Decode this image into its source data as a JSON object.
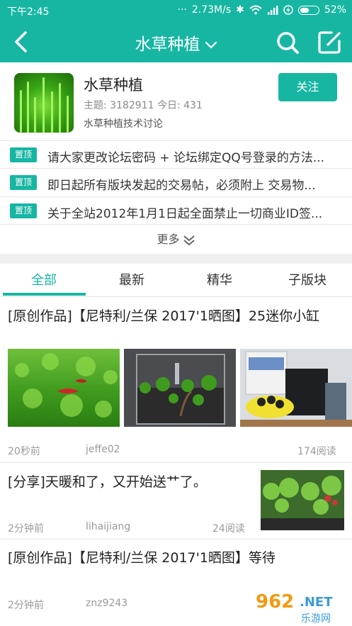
{
  "status_bar": {
    "time": "下午2:45",
    "speed": "2.73M/s",
    "battery": "52%",
    "battery_level": 0.52
  },
  "header": {
    "title": "水草种植",
    "back_icon": "back-arrow-icon",
    "search_icon": "search-icon",
    "compose_icon": "compose-icon"
  },
  "forum": {
    "name": "水草种植",
    "stats": "主题: 3182911  今日: 431",
    "description": "水草种植技术讨论",
    "follow_label": "关注"
  },
  "pinned": [
    {
      "badge": "置顶",
      "text": "请大家更改论坛密码 + 论坛绑定QQ号登录的方法..."
    },
    {
      "badge": "置顶",
      "text": "即日起所有版块发起的交易帖，必须附上 交易物..."
    },
    {
      "badge": "置顶",
      "text": "关于全站2012年1月1日起全面禁止一切商业ID签..."
    }
  ],
  "more_label": "更多",
  "tabs": [
    "全部",
    "最新",
    "精华",
    "子版块"
  ],
  "posts": [
    {
      "title": "[原创作品]【尼特利/兰保 2017'1晒图】25迷你小缸",
      "time": "20秒前",
      "author": "jeffe02",
      "views": "174阅读"
    },
    {
      "title": "[分享]天暖和了，又开始送艹了。",
      "time": "2分钟前",
      "author": "lihaijiang",
      "views": "24阅读"
    },
    {
      "title": "[原创作品]【尼特利/兰保 2017'1晒图】等待",
      "time": "2分钟前",
      "author": "znz9243",
      "views": ""
    }
  ],
  "watermark": {
    "main": "962.NET",
    "sub": "乐游网"
  },
  "colors": {
    "accent": "#17b6a3"
  }
}
